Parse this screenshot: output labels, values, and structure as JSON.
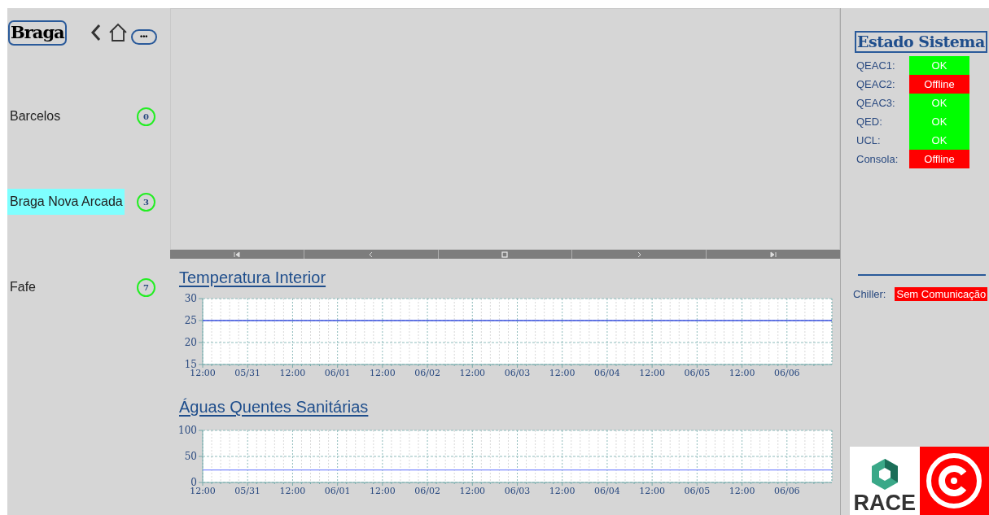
{
  "header": {
    "title": "Braga",
    "more_button": "•••"
  },
  "sites": [
    {
      "name": "Barcelos",
      "count": "0",
      "selected": false
    },
    {
      "name": "Braga Nova Arcada",
      "count": "3",
      "selected": true
    },
    {
      "name": "Fafe",
      "count": "7",
      "selected": false
    }
  ],
  "charts": [
    {
      "title": "Temperatura Interior",
      "chart_data": {
        "type": "line",
        "categories": [
          "12:00",
          "05/31",
          "12:00",
          "06/01",
          "12:00",
          "06/02",
          "12:00",
          "06/03",
          "12:00",
          "06/04",
          "12:00",
          "06/05",
          "12:00",
          "06/06",
          null
        ],
        "ylim": [
          15,
          30
        ],
        "yticks": [
          15,
          20,
          25,
          30
        ],
        "grid": true,
        "series": [
          {
            "color": "#3b4fe0",
            "values": [
              25,
              25,
              25,
              25,
              25,
              25,
              25,
              25,
              25,
              25,
              25,
              25,
              25,
              25,
              25
            ]
          }
        ]
      }
    },
    {
      "title": "Águas Quentes Sanitárias",
      "chart_data": {
        "type": "line",
        "categories": [
          "12:00",
          "05/31",
          "12:00",
          "06/01",
          "12:00",
          "06/02",
          "12:00",
          "06/03",
          "12:00",
          "06/04",
          "12:00",
          "06/05",
          "12:00",
          "06/06",
          null
        ],
        "ylim": [
          0,
          100
        ],
        "yticks": [
          0,
          50,
          100
        ],
        "grid": true,
        "series": [
          {
            "color": "#7f8cff",
            "values": [
              24,
              24,
              24,
              24,
              24,
              24,
              24,
              24,
              24,
              24,
              24,
              24,
              24,
              24,
              24
            ]
          }
        ]
      }
    }
  ],
  "status_panel": {
    "title": "Estado Sistema",
    "items": [
      {
        "label": "QEAC1:",
        "status": "OK",
        "color": "#00ff00"
      },
      {
        "label": "QEAC2:",
        "status": "Offline",
        "color": "#ff0000"
      },
      {
        "label": "QEAC3:",
        "status": "OK",
        "color": "#00ff00"
      },
      {
        "label": "QED:",
        "status": "OK",
        "color": "#00ff00"
      },
      {
        "label": "UCL:",
        "status": "OK",
        "color": "#00ff00"
      },
      {
        "label": "Consola:",
        "status": "Offline",
        "color": "#ff0000"
      }
    ],
    "chiller": {
      "label": "Chiller:",
      "status": "Sem Comunicação",
      "color": "#ff0000"
    }
  },
  "logos": {
    "race": "RACE"
  }
}
